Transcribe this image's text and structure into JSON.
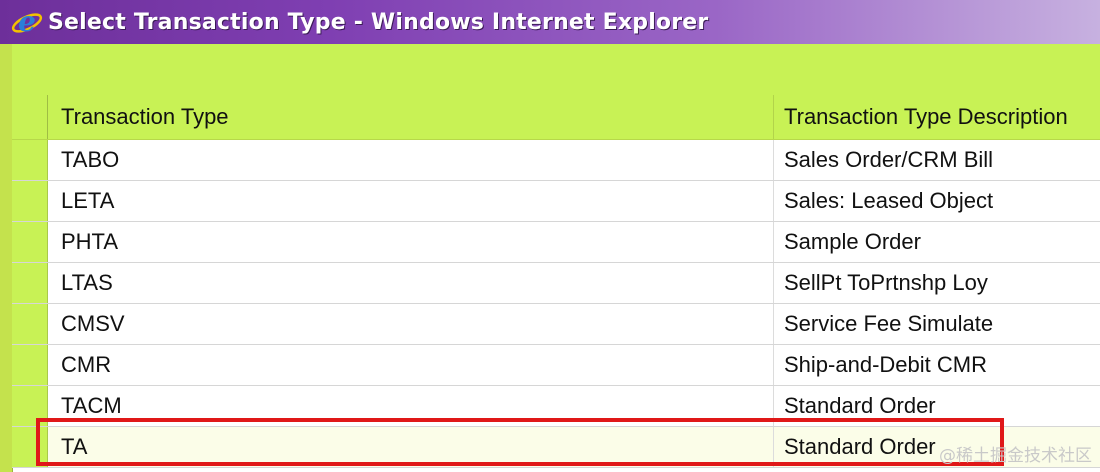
{
  "window": {
    "title": "Select Transaction Type - Windows Internet Explorer",
    "icon": "internet-explorer-icon"
  },
  "table": {
    "columns": [
      "Transaction Type",
      "Transaction Type Description"
    ],
    "rows": [
      {
        "type": "TABO",
        "description": "Sales Order/CRM Bill"
      },
      {
        "type": "LETA",
        "description": "Sales: Leased Object"
      },
      {
        "type": "PHTA",
        "description": "Sample Order"
      },
      {
        "type": "LTAS",
        "description": "SellPt ToPrtnshp Loy"
      },
      {
        "type": "CMSV",
        "description": "Service Fee Simulate"
      },
      {
        "type": "CMR",
        "description": "Ship-and-Debit CMR"
      },
      {
        "type": "TACM",
        "description": "Standard Order"
      },
      {
        "type": "TA",
        "description": "Standard Order"
      }
    ]
  },
  "watermark": "@稀土掘金技术社区",
  "colors": {
    "title_bar": "#7f3fb2",
    "header_band": "#c8f255",
    "highlight": "#e01818"
  }
}
